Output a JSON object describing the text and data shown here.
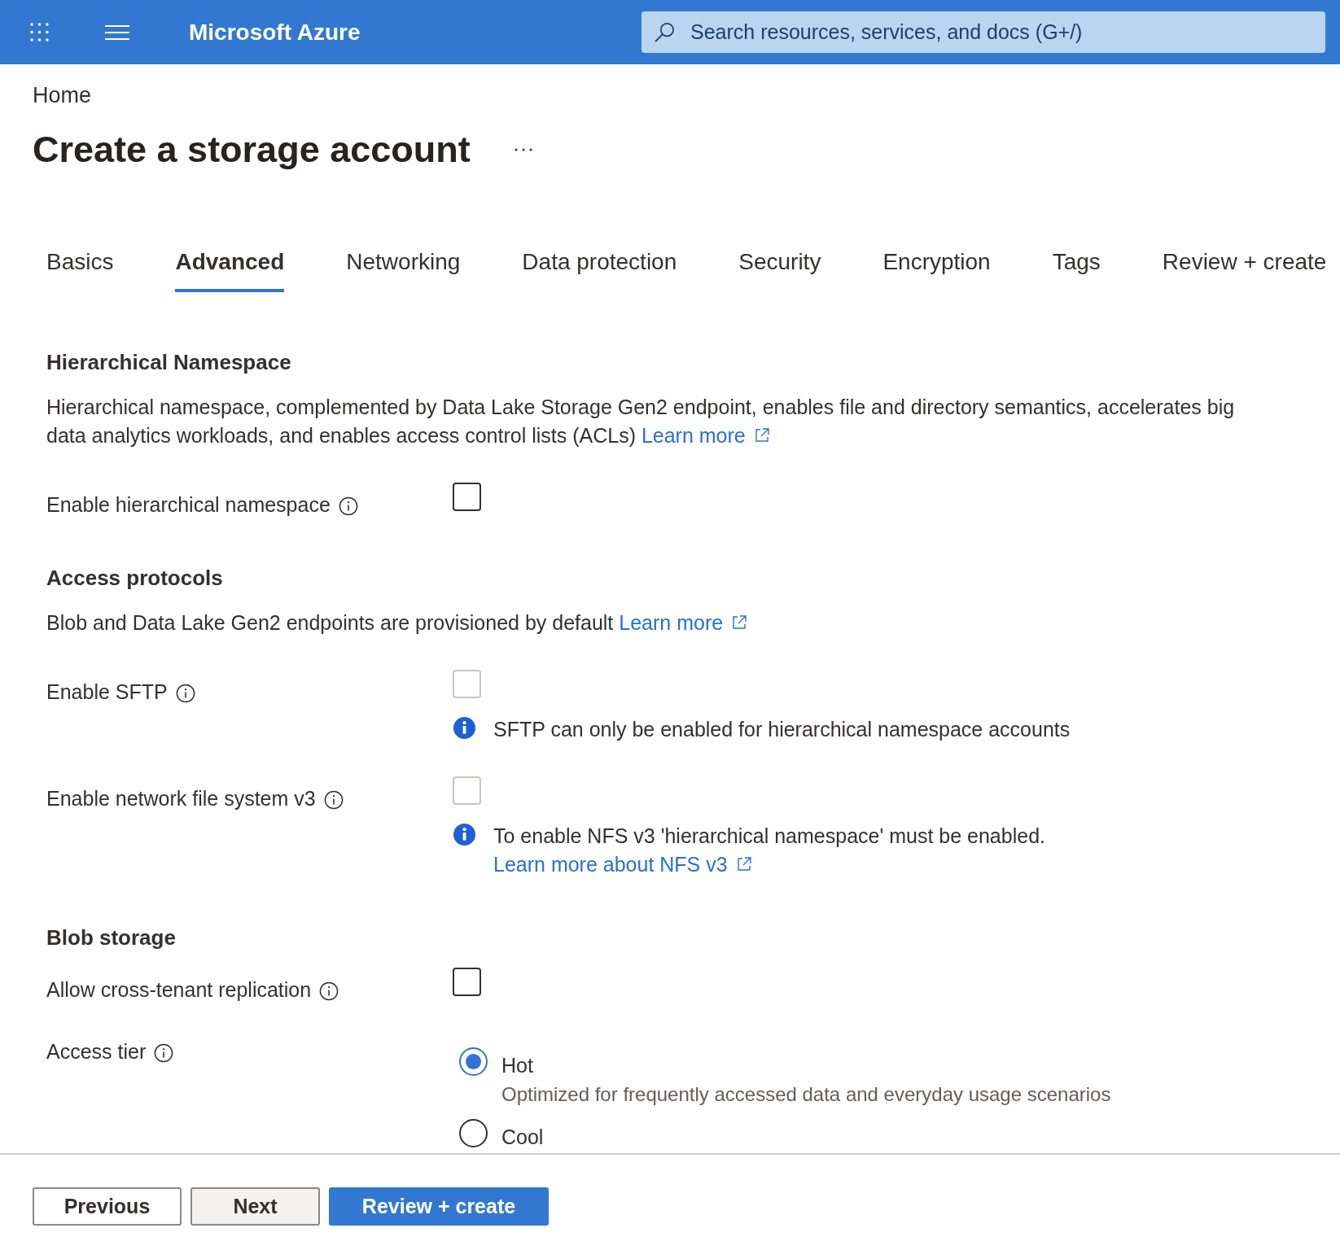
{
  "header": {
    "brand": "Microsoft Azure",
    "search": {
      "placeholder": "Search resources, services, and docs (G+/)"
    }
  },
  "breadcrumb": [
    "Home"
  ],
  "page": {
    "title": "Create a storage account"
  },
  "tabs": [
    {
      "label": "Basics",
      "selected": false
    },
    {
      "label": "Advanced",
      "selected": true
    },
    {
      "label": "Networking",
      "selected": false
    },
    {
      "label": "Data protection",
      "selected": false
    },
    {
      "label": "Security",
      "selected": false
    },
    {
      "label": "Encryption",
      "selected": false
    },
    {
      "label": "Tags",
      "selected": false
    },
    {
      "label": "Review + create",
      "selected": false
    }
  ],
  "sections": [
    {
      "heading": "Hierarchical Namespace",
      "description": {
        "text": "Hierarchical namespace, complemented by Data Lake Storage Gen2 endpoint, enables file and directory semantics, accelerates big data analytics workloads, and enables access control lists (ACLs)",
        "link": "Learn more"
      },
      "fields": [
        {
          "kind": "checkbox",
          "label": "Enable hierarchical namespace",
          "checked": false,
          "disabled": false
        }
      ]
    },
    {
      "heading": "Access protocols",
      "description": {
        "text": "Blob and Data Lake Gen2 endpoints are provisioned by default",
        "link": "Learn more"
      },
      "fields": [
        {
          "kind": "checkbox",
          "label": "Enable SFTP",
          "checked": false,
          "disabled": true,
          "note": {
            "text": "SFTP can only be enabled for hierarchical namespace accounts"
          }
        },
        {
          "kind": "checkbox",
          "label": "Enable network file system v3",
          "checked": false,
          "disabled": true,
          "note": {
            "text": "To enable NFS v3 'hierarchical namespace' must be enabled.",
            "link": "Learn more about NFS v3"
          }
        }
      ]
    },
    {
      "heading": "Blob storage",
      "fields": [
        {
          "kind": "checkbox",
          "label": "Allow cross-tenant replication",
          "checked": false,
          "disabled": false
        },
        {
          "kind": "radio",
          "label": "Access tier",
          "options": [
            {
              "label": "Hot",
              "description": "Optimized for frequently accessed data and everyday usage scenarios",
              "selected": true
            },
            {
              "label": "Cool",
              "selected": false
            }
          ]
        }
      ]
    }
  ],
  "footer": {
    "buttons": [
      {
        "label": "Previous",
        "kind": "secondary"
      },
      {
        "label": "Next",
        "kind": "default"
      },
      {
        "label": "Review + create",
        "kind": "primary"
      }
    ]
  }
}
